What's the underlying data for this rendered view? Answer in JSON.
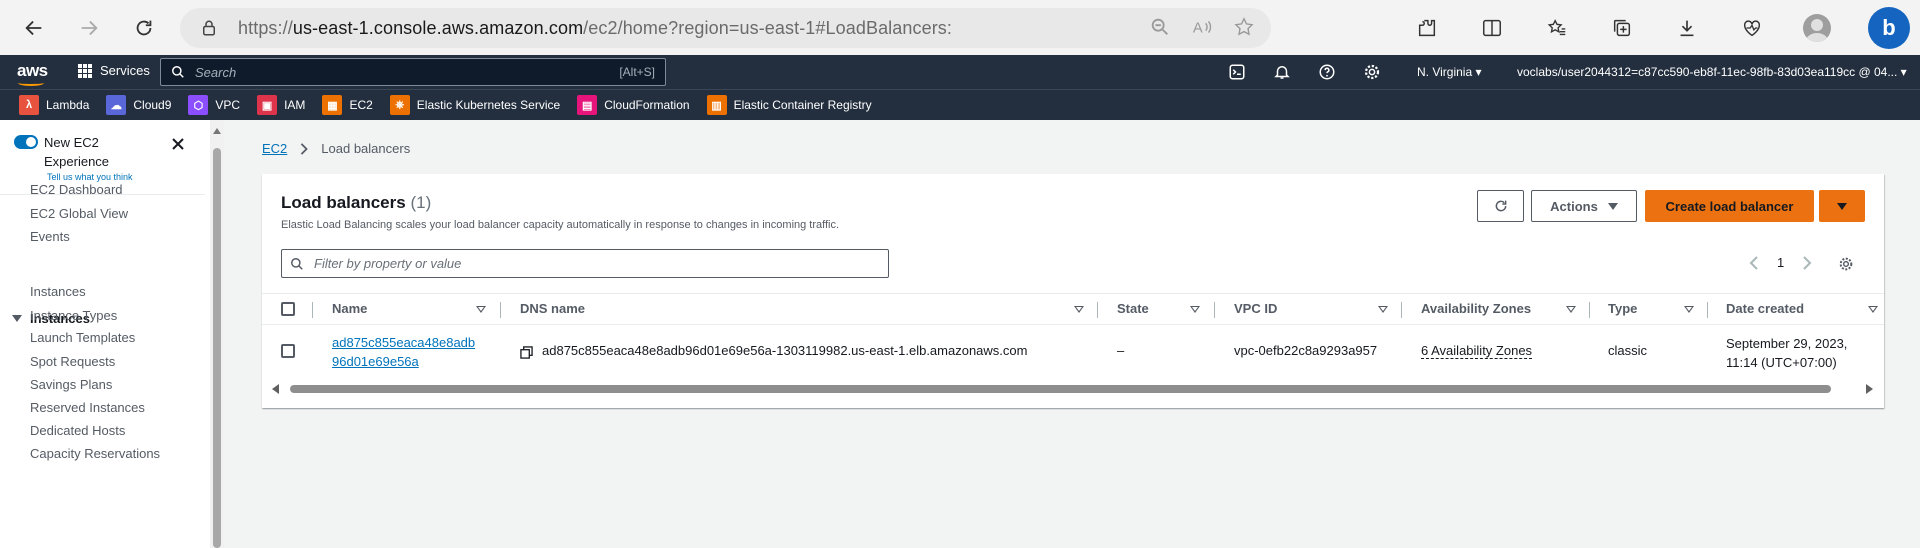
{
  "browser": {
    "url_prefix": "https://",
    "url_domain": "us-east-1.console.aws.amazon.com",
    "url_path": "/ec2/home?region=us-east-1#LoadBalancers:"
  },
  "aws_nav": {
    "logo": "aws",
    "services_label": "Services",
    "search_placeholder": "Search",
    "search_shortcut": "[Alt+S]",
    "region": "N. Virginia",
    "account": "voclabs/user2044312=c87cc590-eb8f-11ec-98fb-83d03ea119cc @ 04..."
  },
  "favorites": [
    {
      "label": "Lambda",
      "color": "#e7533f",
      "glyph": "λ"
    },
    {
      "label": "Cloud9",
      "color": "#5a67d8",
      "glyph": "☁"
    },
    {
      "label": "VPC",
      "color": "#8c4fff",
      "glyph": "⬡"
    },
    {
      "label": "IAM",
      "color": "#dd344c",
      "glyph": "▣"
    },
    {
      "label": "EC2",
      "color": "#ed7100",
      "glyph": "▦"
    },
    {
      "label": "Elastic Kubernetes Service",
      "color": "#ed7100",
      "glyph": "⎈"
    },
    {
      "label": "CloudFormation",
      "color": "#e7157b",
      "glyph": "▤"
    },
    {
      "label": "Elastic Container Registry",
      "color": "#ed7100",
      "glyph": "▥"
    }
  ],
  "sidebar": {
    "new_experience": "New EC2 Experience",
    "feedback": "Tell us what you think",
    "top_items": [
      "EC2 Dashboard",
      "EC2 Global View",
      "Events"
    ],
    "section": "Instances",
    "section_items": [
      "Instances",
      "Instance Types",
      "Launch Templates",
      "Spot Requests",
      "Savings Plans",
      "Reserved Instances",
      "Dedicated Hosts",
      "Capacity Reservations"
    ]
  },
  "breadcrumb": {
    "root": "EC2",
    "current": "Load balancers"
  },
  "panel": {
    "title": "Load balancers",
    "count": "(1)",
    "description": "Elastic Load Balancing scales your load balancer capacity automatically in response to changes in incoming traffic.",
    "actions_label": "Actions",
    "create_label": "Create load balancer",
    "filter_placeholder": "Filter by property or value",
    "page": "1"
  },
  "table": {
    "columns": [
      "Name",
      "DNS name",
      "State",
      "VPC ID",
      "Availability Zones",
      "Type",
      "Date created"
    ],
    "rows": [
      {
        "name_line1": "ad875c855eaca48e8adb",
        "name_line2": "96d01e69e56a",
        "dns": "ad875c855eaca48e8adb96d01e69e56a-1303119982.us-east-1.elb.amazonaws.com",
        "state": "–",
        "vpc": "vpc-0efb22c8a9293a957",
        "azs": "6 Availability Zones",
        "type": "classic",
        "date_line1": "September 29, 2023,",
        "date_line2": "11:14 (UTC+07:00)"
      }
    ]
  },
  "colors": {
    "accent": "#0073bb",
    "primary_button": "#ec7211",
    "nav_bg": "#232f3e"
  }
}
